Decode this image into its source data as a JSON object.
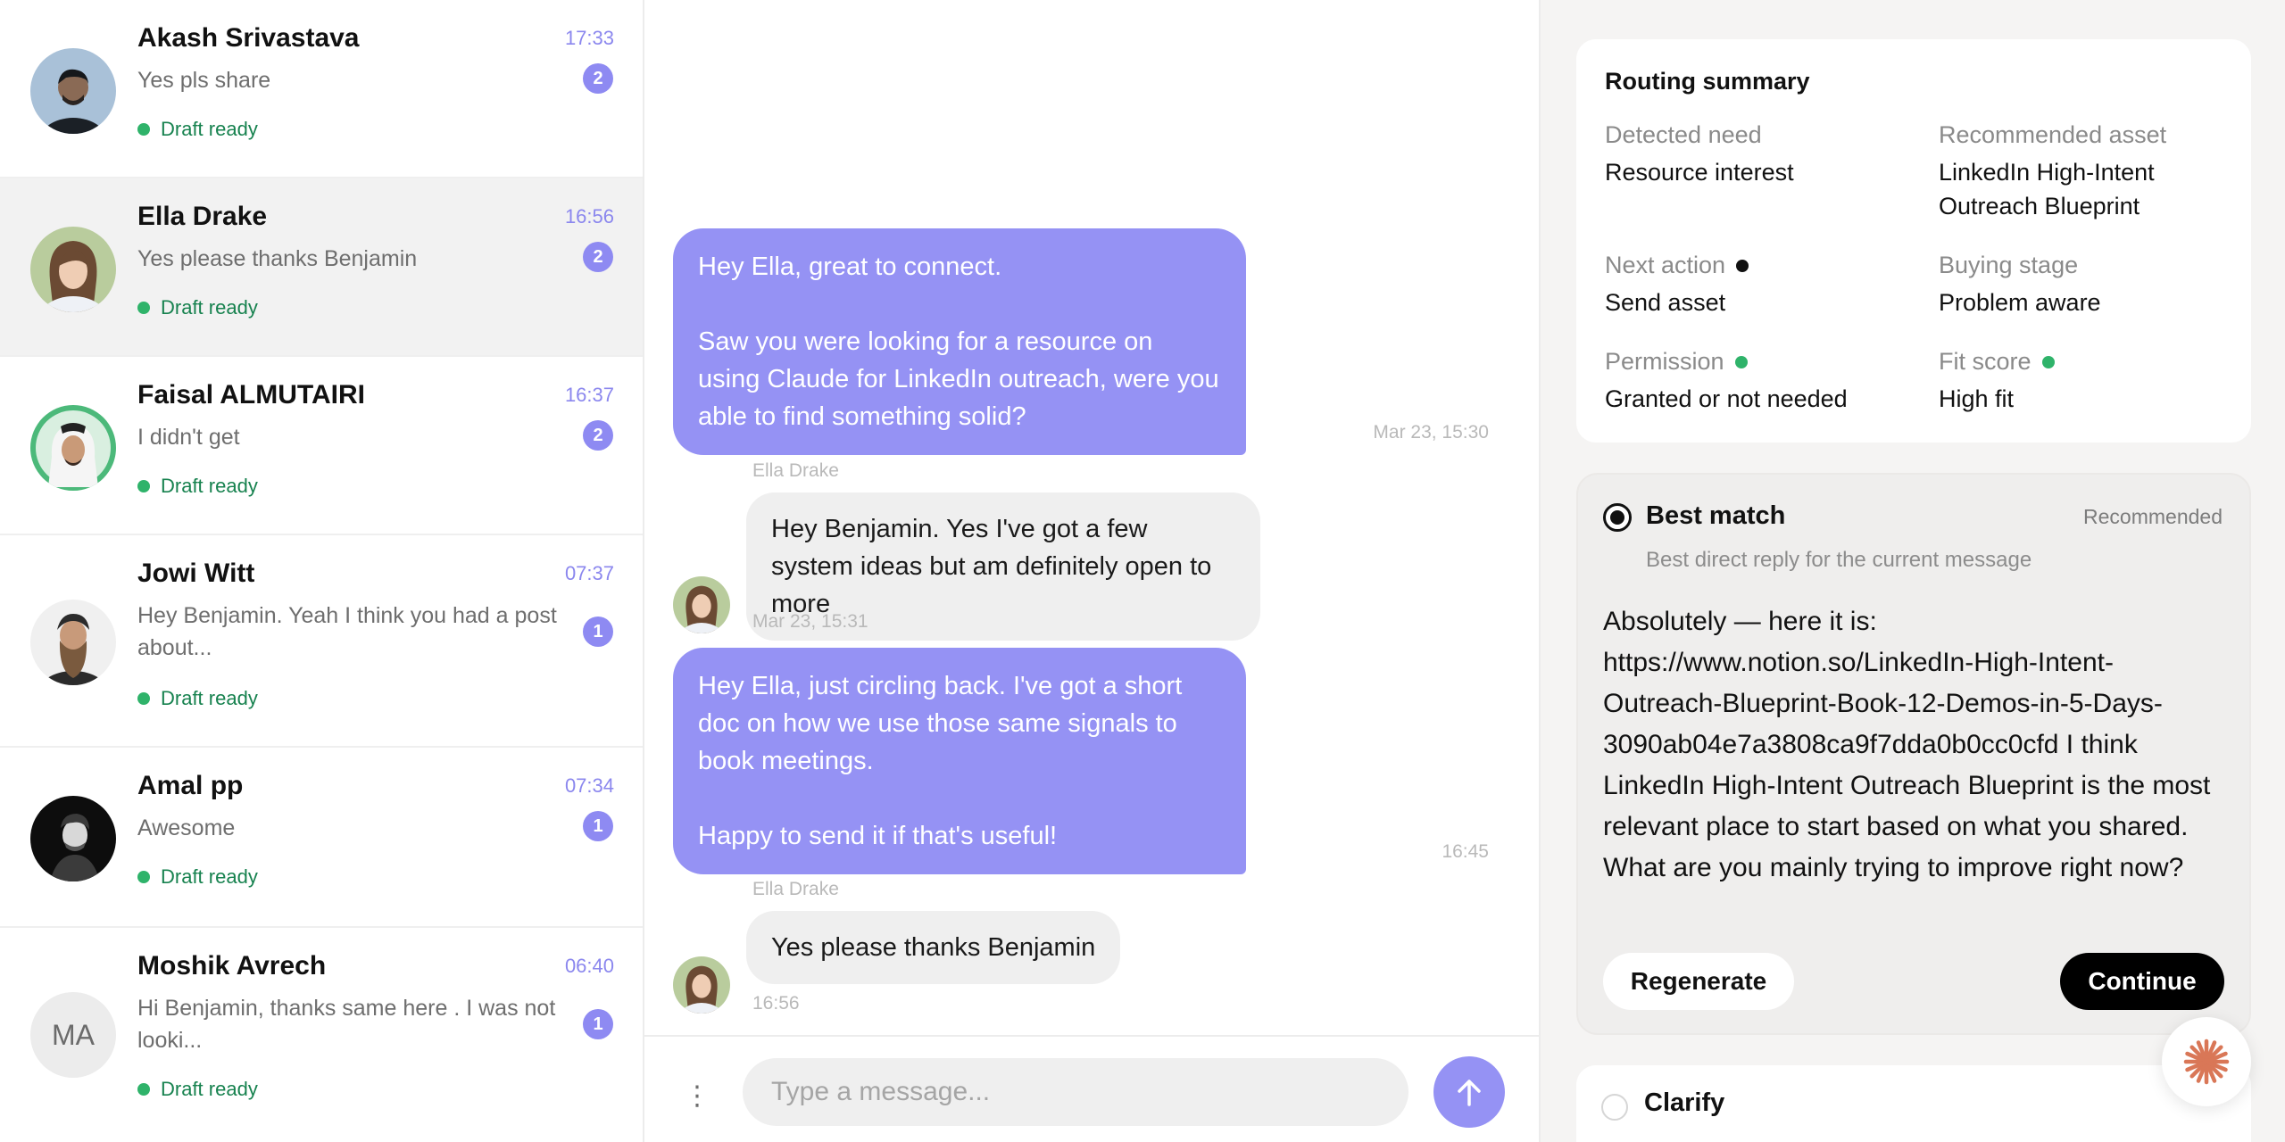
{
  "conversations": [
    {
      "name": "Akash Srivastava",
      "time": "17:33",
      "preview": "Yes pls share",
      "badge": "2",
      "status": "Draft ready"
    },
    {
      "name": "Ella Drake",
      "time": "16:56",
      "preview": "Yes please thanks Benjamin",
      "badge": "2",
      "status": "Draft ready"
    },
    {
      "name": "Faisal ALMUTAIRI",
      "time": "16:37",
      "preview": "I didn't get",
      "badge": "2",
      "status": "Draft ready"
    },
    {
      "name": "Jowi Witt",
      "time": "07:37",
      "preview": "Hey Benjamin. Yeah I think you had a post about...",
      "badge": "1",
      "status": "Draft ready"
    },
    {
      "name": "Amal pp",
      "time": "07:34",
      "preview": "Awesome",
      "badge": "1",
      "status": "Draft ready"
    },
    {
      "name": "Moshik Avrech",
      "initials": "MA",
      "time": "06:40",
      "preview": "Hi Benjamin, thanks same here . I was not looki...",
      "badge": "1",
      "status": "Draft ready"
    }
  ],
  "chat": {
    "messages": [
      {
        "direction": "out",
        "text_1": "Hey Ella, great to connect.",
        "text_2": "Saw you were looking for a resource on using Claude for LinkedIn outreach, were you able to find something solid?",
        "meta": "Mar 23, 15:30"
      },
      {
        "direction": "in",
        "sender": "Ella Drake",
        "text": "Hey Benjamin. Yes I've got a few system ideas but am definitely open to more",
        "meta": "Mar 23, 15:31"
      },
      {
        "direction": "out",
        "text_1": "Hey Ella, just circling back. I've got a short doc on how we use those same signals to book meetings.",
        "text_2": "Happy to send it if that's useful!",
        "meta": "16:45"
      },
      {
        "direction": "in",
        "sender": "Ella Drake",
        "text": "Yes please thanks Benjamin",
        "meta": "16:56"
      }
    ],
    "composer_placeholder": "Type a message..."
  },
  "routing": {
    "title": "Routing summary",
    "detected_need_label": "Detected need",
    "detected_need_value": "Resource interest",
    "recommended_asset_label": "Recommended asset",
    "recommended_asset_value": "LinkedIn High-Intent Outreach Blueprint",
    "next_action_label": "Next action",
    "next_action_value": "Send asset",
    "buying_stage_label": "Buying stage",
    "buying_stage_value": "Problem aware",
    "permission_label": "Permission",
    "permission_value": "Granted or not needed",
    "fit_score_label": "Fit score",
    "fit_score_value": "High fit"
  },
  "best_match": {
    "title": "Best match",
    "tag": "Recommended",
    "subtitle": "Best direct reply for the current message",
    "body": "Absolutely — here it is: https://www.notion.so/LinkedIn-High-Intent-Outreach-Blueprint-Book-12-Demos-in-5-Days-3090ab04e7a3808ca9f7dda0b0cc0cfd I think LinkedIn High-Intent Outreach Blueprint is the most relevant place to start based on what you shared. What are you mainly trying to improve right now?",
    "regenerate_label": "Regenerate",
    "continue_label": "Continue"
  },
  "clarify": {
    "title": "Clarify"
  },
  "colors": {
    "accent": "#9592f4",
    "status_green": "#2fb36a",
    "status_text": "#17824f",
    "time": "#8b87ee",
    "fab_icon": "#d97757"
  }
}
